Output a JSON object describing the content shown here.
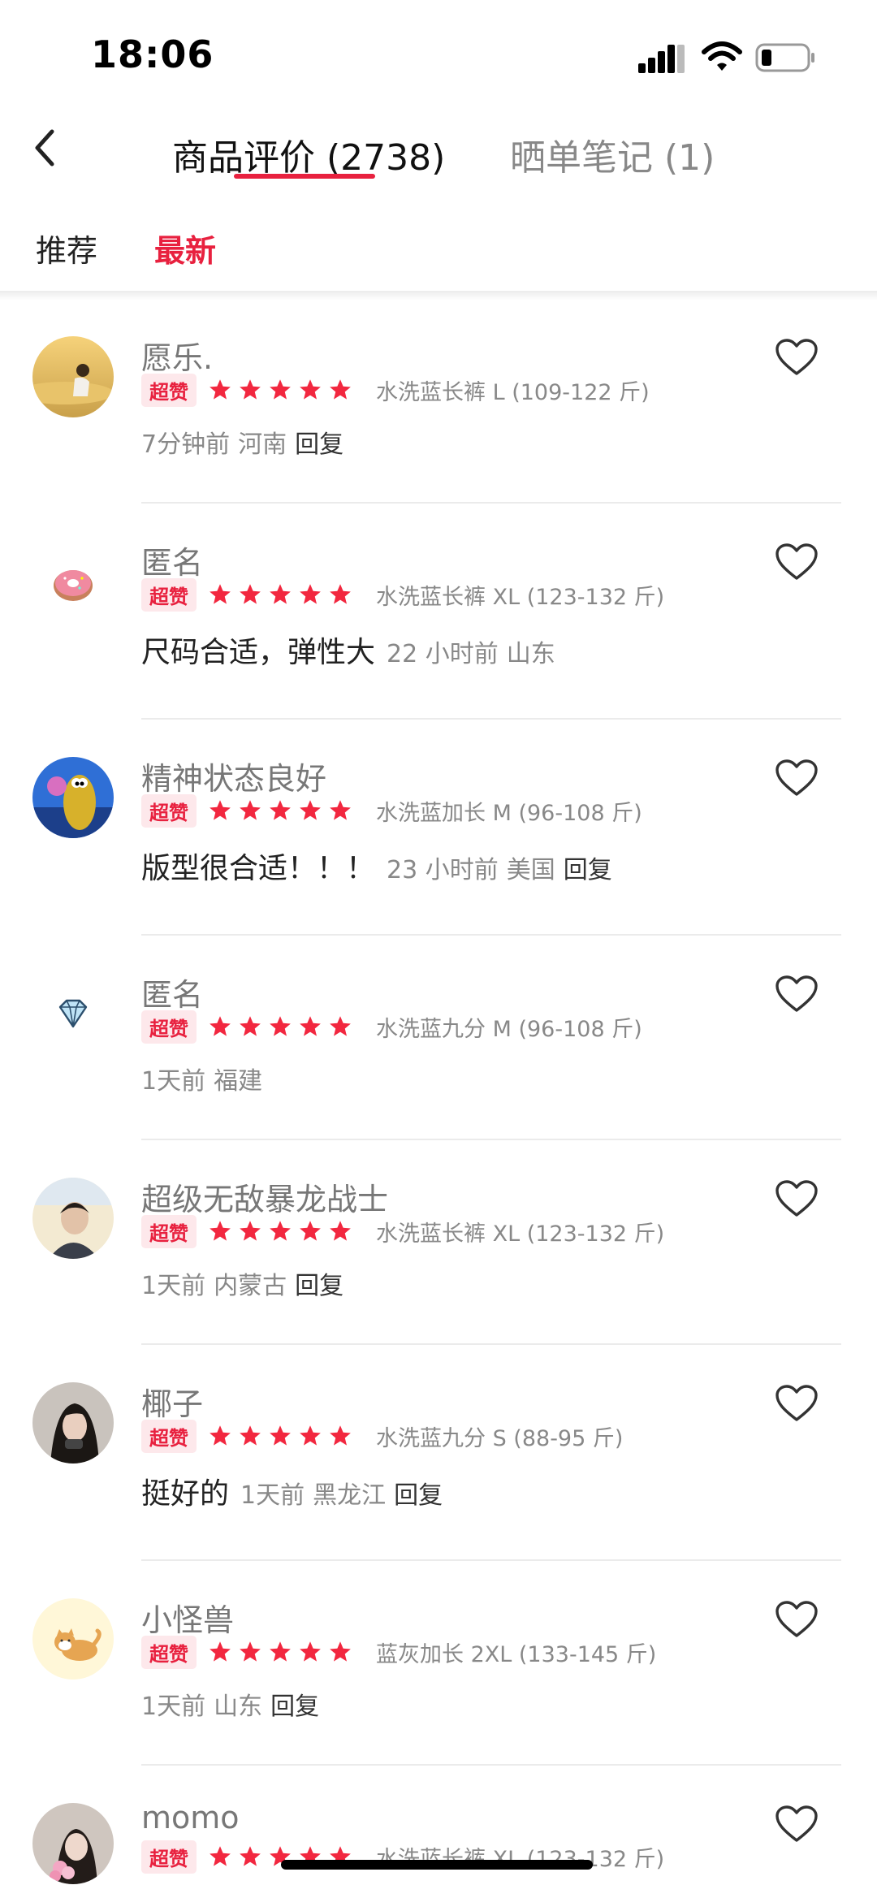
{
  "status_bar": {
    "time": "18:06"
  },
  "header": {
    "tabs": [
      {
        "label": "商品评价 (2738)",
        "active": true
      },
      {
        "label": "晒单笔记 (1)",
        "active": false
      }
    ],
    "accent_color": "#e8213f"
  },
  "sort_tabs": [
    {
      "label": "推荐",
      "active": false
    },
    {
      "label": "最新",
      "active": true
    }
  ],
  "reviews": [
    {
      "name": "愿乐.",
      "badge": "超赞",
      "rating": 5,
      "spec": "水洗蓝长裤  L (109-122 斤)",
      "content": "",
      "time": "7分钟前",
      "location": "河南",
      "reply": "回复"
    },
    {
      "name": "匿名",
      "badge": "超赞",
      "rating": 5,
      "spec": "水洗蓝长裤  XL (123-132 斤)",
      "content": "尺码合适，弹性大",
      "time": "22 小时前",
      "location": "山东",
      "reply": ""
    },
    {
      "name": "精神状态良好",
      "badge": "超赞",
      "rating": 5,
      "spec": "水洗蓝加长  M (96-108 斤)",
      "content": "版型很合适！！！",
      "time": "23 小时前",
      "location": "美国",
      "reply": "回复"
    },
    {
      "name": "匿名",
      "badge": "超赞",
      "rating": 5,
      "spec": "水洗蓝九分  M (96-108 斤)",
      "content": "",
      "time": "1天前",
      "location": "福建",
      "reply": ""
    },
    {
      "name": "超级无敌暴龙战士",
      "badge": "超赞",
      "rating": 5,
      "spec": "水洗蓝长裤  XL (123-132 斤)",
      "content": "",
      "time": "1天前",
      "location": "内蒙古",
      "reply": "回复"
    },
    {
      "name": "椰子",
      "badge": "超赞",
      "rating": 5,
      "spec": "水洗蓝九分  S (88-95 斤)",
      "content": "挺好的",
      "time": "1天前",
      "location": "黑龙江",
      "reply": "回复"
    },
    {
      "name": "小怪兽",
      "badge": "超赞",
      "rating": 5,
      "spec": "蓝灰加长  2XL (133-145 斤)",
      "content": "",
      "time": "1天前",
      "location": "山东",
      "reply": "回复"
    },
    {
      "name": "momo",
      "badge": "超赞",
      "rating": 5,
      "spec": "水洗蓝长裤  XL (123-132 斤)",
      "content": "",
      "time": "",
      "location": "",
      "reply": ""
    }
  ]
}
